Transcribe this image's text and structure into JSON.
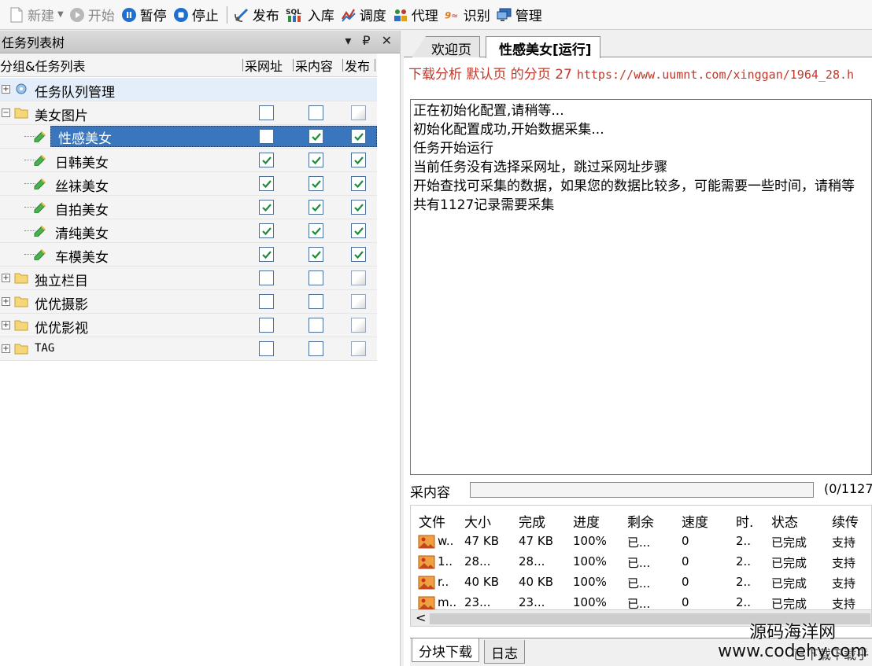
{
  "toolbar": {
    "new": "新建",
    "start": "开始",
    "pause": "暂停",
    "stop": "停止",
    "publish": "发布",
    "import": "入库",
    "schedule": "调度",
    "proxy": "代理",
    "recognize": "识别",
    "manage": "管理",
    "sql_badge": "SQL"
  },
  "left_panel": {
    "title": "任务列表树",
    "pin": "▼ ₽ ✕",
    "col_name": "分组&任务列表",
    "col_url": "采网址",
    "col_content": "采内容",
    "col_publish": "发布"
  },
  "tree": {
    "queue": "任务队列管理",
    "group1": "美女图片",
    "items": [
      "性感美女",
      "日韩美女",
      "丝袜美女",
      "自拍美女",
      "清纯美女",
      "车模美女"
    ],
    "groups": [
      "独立栏目",
      "优优摄影",
      "优优影视",
      "TAG"
    ]
  },
  "right_panel": {
    "tab_welcome": "欢迎页",
    "tab_task": "性感美女[运行]",
    "info_prefix": "下载分析 默认页 的分页 27",
    "info_url": "https://www.uumnt.com/xinggan/1964_28.h",
    "log": [
      "正在初始化配置,请稍等...",
      "初始化配置成功,开始数据采集...",
      "任务开始运行",
      "当前任务没有选择采网址，跳过采网址步骤",
      "开始查找可采集的数据，如果您的数据比较多，可能需要一些时间，请稍等",
      "共有1127记录需要采集"
    ],
    "progress_label": "采内容",
    "progress_count": "(0/1127",
    "progress": 0,
    "dl_headers": [
      "文件",
      "大小",
      "完成",
      "进度",
      "剩余",
      "速度",
      "时.",
      "状态",
      "续传"
    ],
    "dl_rows": [
      [
        "w..",
        "47 KB",
        "47 KB",
        "100%",
        "已...",
        "0",
        "2..",
        "已完成",
        "支持"
      ],
      [
        "1..",
        "28...",
        "28...",
        "100%",
        "已...",
        "0",
        "2..",
        "已完成",
        "支持"
      ],
      [
        "r..",
        "40 KB",
        "40 KB",
        "100%",
        "已...",
        "0",
        "2..",
        "已完成",
        "支持"
      ],
      [
        "m..",
        "23...",
        "23...",
        "100%",
        "已...",
        "0",
        "2..",
        "已完成",
        "支持"
      ]
    ],
    "scroll_left": "<",
    "btab_block": "分块下载",
    "btab_log": "日志",
    "btab_more": "已下载下载乎"
  },
  "watermark": {
    "line1": "源码海洋网",
    "line2": "www.codehy.com"
  }
}
